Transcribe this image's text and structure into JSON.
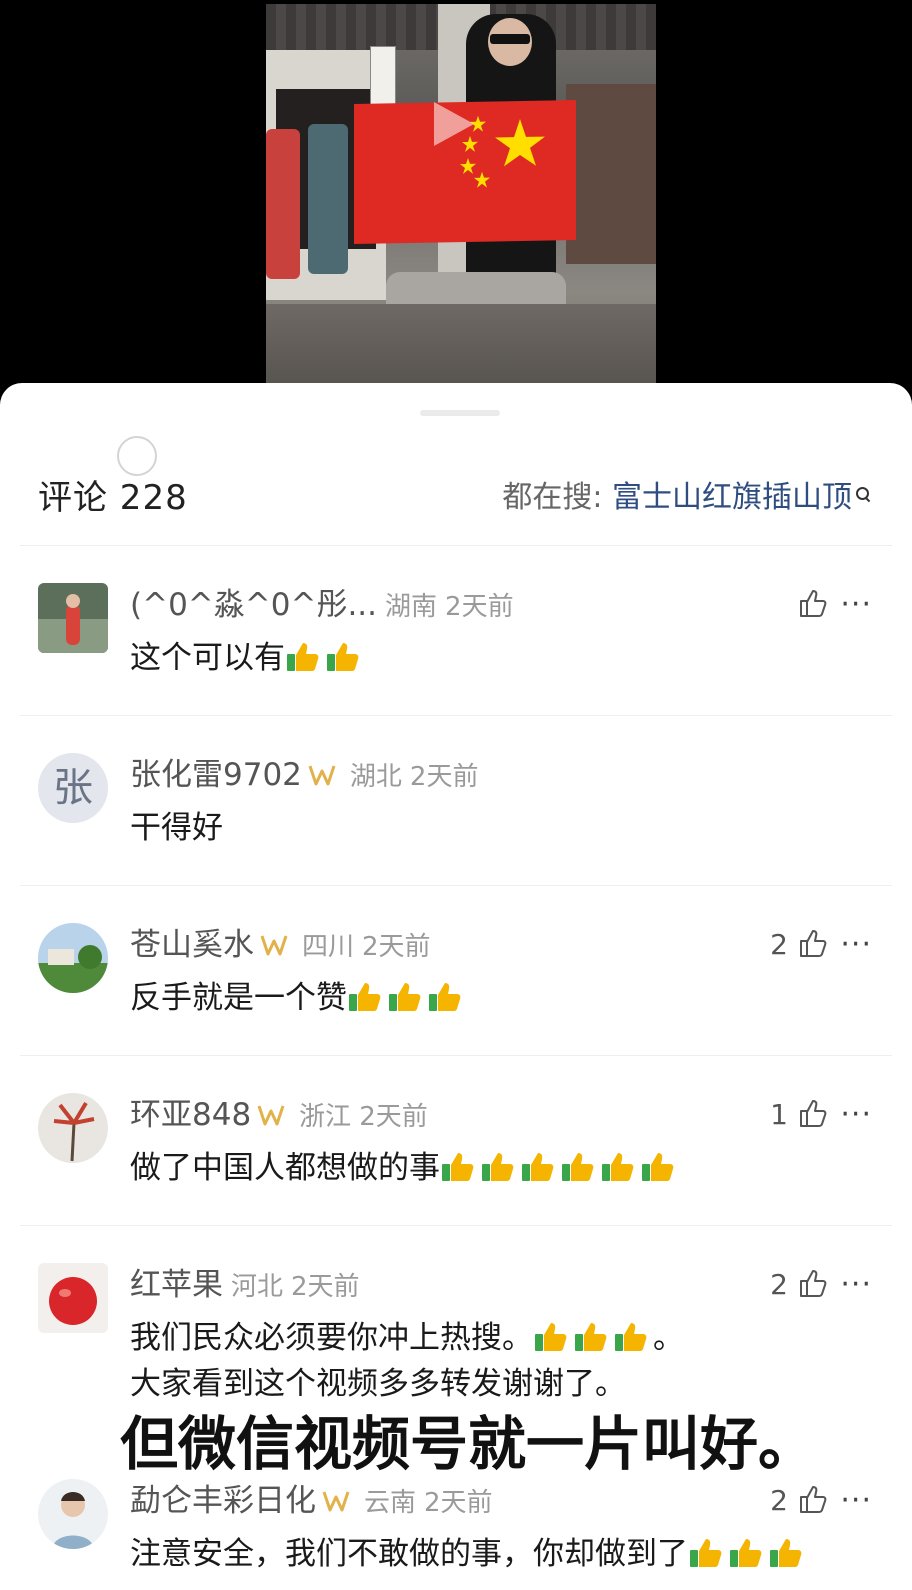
{
  "video": {
    "flag_color": "#de2a23"
  },
  "header": {
    "comment_count": "评论 228",
    "search_prefix": "都在搜: ",
    "search_term": "富士山红旗插山顶"
  },
  "comments": [
    {
      "name": "(^0^淼^0^彤...",
      "region": "湖南",
      "time": "2天前",
      "text": "这个可以有",
      "thumbs": 2,
      "likes": "",
      "vip": false
    },
    {
      "name": "张化雷9702",
      "region": "湖北",
      "time": "2天前",
      "text": "干得好",
      "thumbs": 0,
      "likes": "",
      "vip": true,
      "avatar_text": "张"
    },
    {
      "name": "苍山奚水",
      "region": "四川",
      "time": "2天前",
      "text": "反手就是一个赞",
      "thumbs": 3,
      "likes": "2",
      "vip": true
    },
    {
      "name": "环亚848",
      "region": "浙江",
      "time": "2天前",
      "text": "做了中国人都想做的事",
      "thumbs": 6,
      "likes": "1",
      "vip": true
    },
    {
      "name": "红苹果",
      "region": "河北",
      "time": "2天前",
      "text": "我们民众必须要你冲上热搜。",
      "text_suffix": "。",
      "text2": "大家看到这个视频多多转发谢谢了。",
      "thumbs": 3,
      "likes": "2",
      "vip": false
    },
    {
      "name": "勐仑丰彩日化",
      "region": "云南",
      "time": "2天前",
      "text": "注意安全，我们不敢做的事，你却做到了",
      "thumbs": 3,
      "likes": "2",
      "vip": true
    }
  ],
  "overlay_caption": "但微信视频号就一片叫好。",
  "colors": {
    "search_term": "#2f4d80",
    "thumb_yellow": "#f4b400",
    "thumb_green": "#3aa64a"
  }
}
